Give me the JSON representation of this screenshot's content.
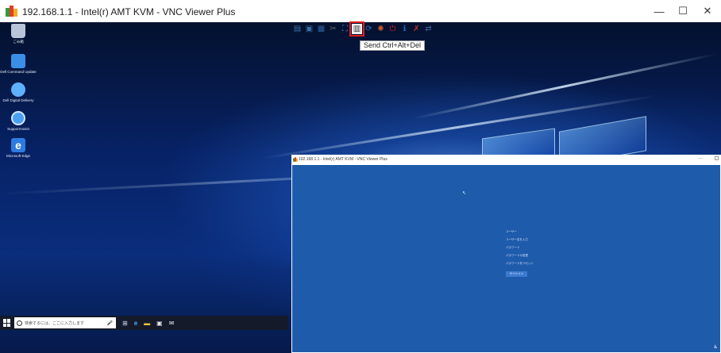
{
  "window": {
    "title": "192.168.1.1 - Intel(r) AMT KVM - VNC Viewer Plus",
    "minimize_glyph": "—",
    "maximize_glyph": "☐",
    "close_glyph": "✕",
    "icon": "vnc-app-icon"
  },
  "toolbar": {
    "items": [
      {
        "name": "options-icon",
        "glyph": "▤",
        "color": "#3a6ea5"
      },
      {
        "name": "save-icon",
        "glyph": "▣",
        "color": "#3a6ea5"
      },
      {
        "name": "display-icon",
        "glyph": "▦",
        "color": "#2f5f9e"
      },
      {
        "name": "tools-icon",
        "glyph": "✂",
        "color": "#6a6a6a"
      },
      {
        "name": "fullscreen-icon",
        "glyph": "⛶",
        "color": "#4a7dbf"
      },
      {
        "name": "send-ctrl-alt-del-icon",
        "glyph": "▥",
        "color": "#333333",
        "highlighted": true
      },
      {
        "name": "refresh-icon",
        "glyph": "⟳",
        "color": "#2f6fb0"
      },
      {
        "name": "globe-icon",
        "glyph": "✺",
        "color": "#d55a2a"
      },
      {
        "name": "power-icon",
        "glyph": "⏻",
        "color": "#d02020"
      },
      {
        "name": "info-icon",
        "glyph": "ℹ",
        "color": "#1e6cc8"
      },
      {
        "name": "disconnect-icon",
        "glyph": "✗",
        "color": "#c03030"
      },
      {
        "name": "connect-icon",
        "glyph": "⇄",
        "color": "#3a6ea5"
      }
    ],
    "tooltip": "Send Ctrl+Alt+Del"
  },
  "desktop": {
    "icons": [
      {
        "label": "ごみ箱",
        "color": "#b8c4d8",
        "icon": "recycle-bin-icon"
      },
      {
        "label": "Dell Command Update",
        "color": "#3a8ee6",
        "icon": "dell-command-update-icon"
      },
      {
        "label": "Dell Digital Delivery",
        "color": "#5fb0ff",
        "icon": "dell-digital-delivery-icon"
      },
      {
        "label": "SupportAssist",
        "color": "#4aa0f0",
        "icon": "supportassist-icon"
      },
      {
        "label": "Microsoft Edge",
        "color": "#2d7be0",
        "icon": "edge-icon"
      }
    ]
  },
  "taskbar": {
    "search_placeholder": "検索するには、ここに入力します",
    "mic_glyph": "🎤",
    "taskview_glyph": "⊞",
    "edge_glyph": "e",
    "explorer_glyph": "▬",
    "store_glyph": "▣",
    "mail_glyph": "✉"
  },
  "inner_window": {
    "title": "192.168.1.1 - Intel(r) AMT KVM - VNC Viewer Plus",
    "lock_lines": [
      "ユーザー",
      "ユーザー名を入力",
      "パスワード",
      "パスワードの変更",
      "パスワードをリセット"
    ],
    "signin_label": "サインイン"
  }
}
